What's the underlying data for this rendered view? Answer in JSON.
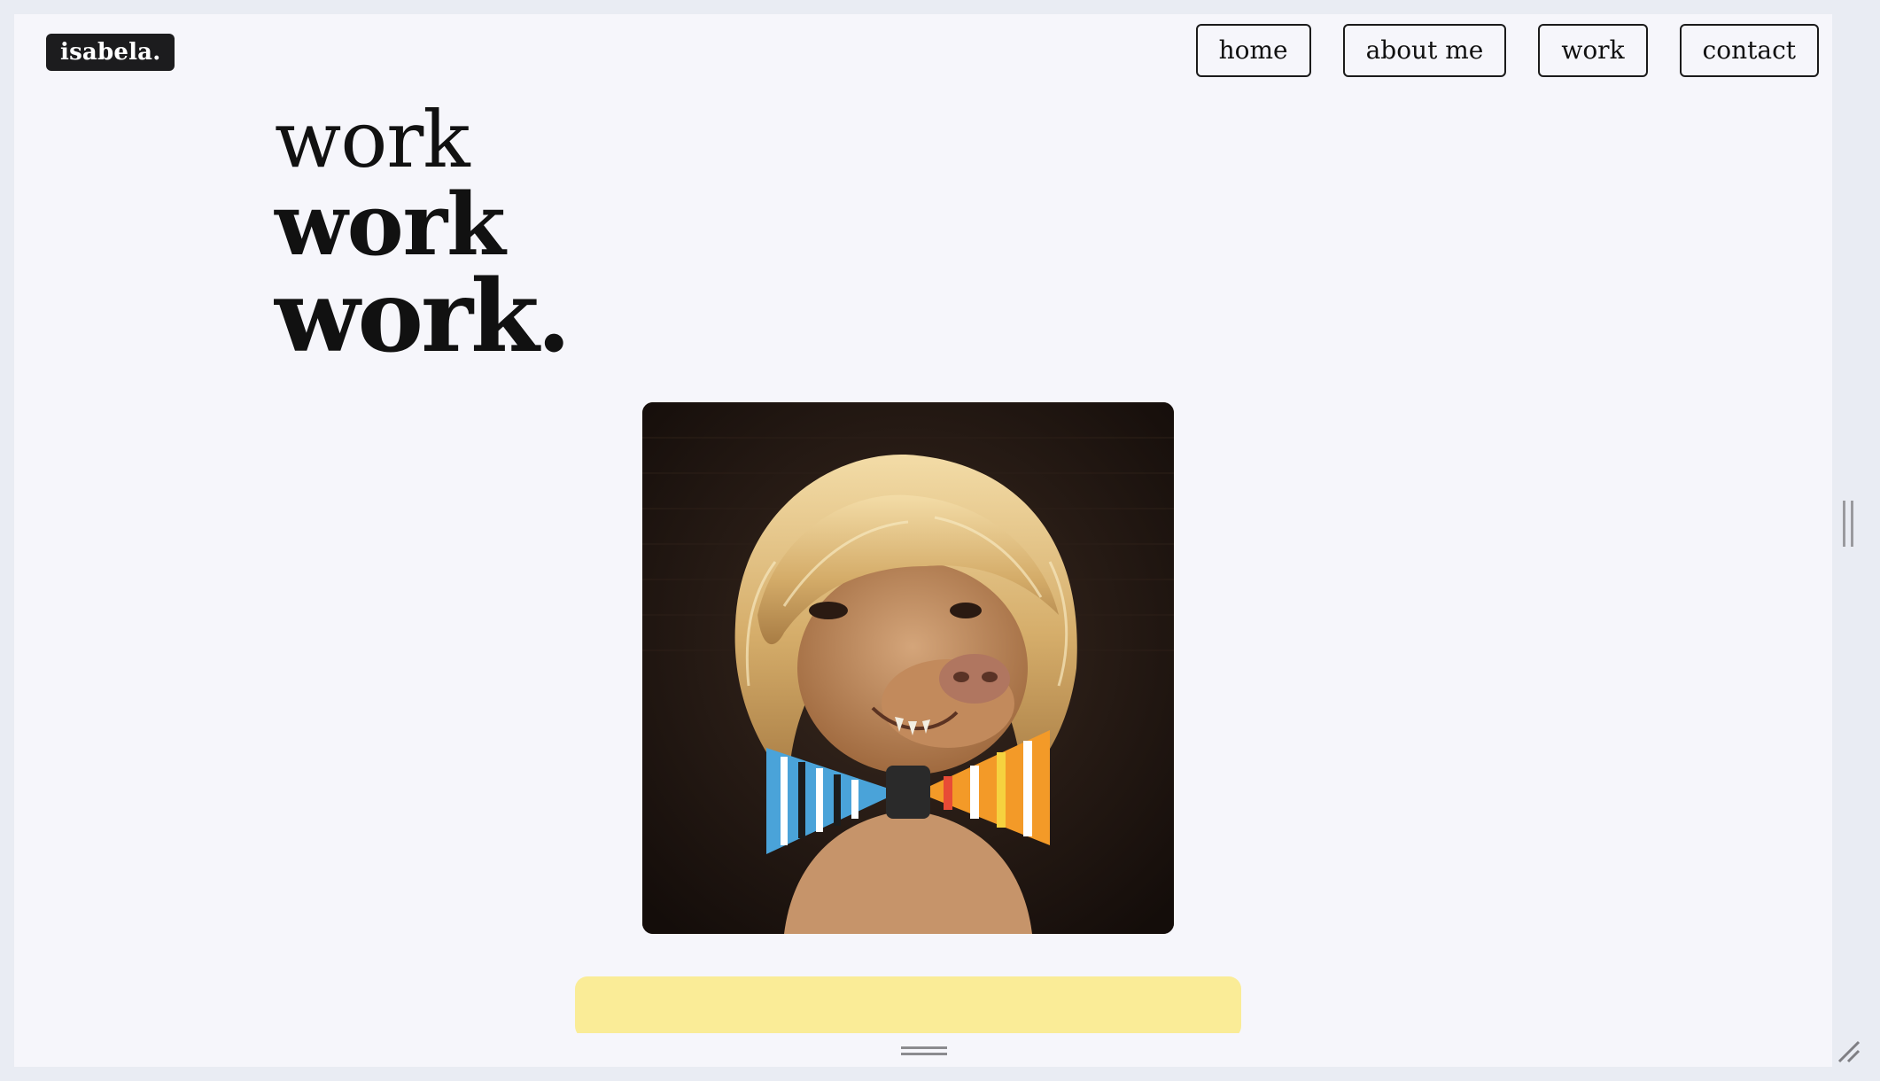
{
  "brand": {
    "logo_text": "isabela."
  },
  "nav": {
    "items": [
      {
        "label": "home"
      },
      {
        "label": "about me"
      },
      {
        "label": "work"
      },
      {
        "label": "contact"
      }
    ]
  },
  "hero": {
    "line1": "work",
    "line2": "work",
    "line3": "work."
  },
  "photo": {
    "subject_icon": "dog-in-wig-with-bowtie-image"
  },
  "colors": {
    "page_bg": "#f6f6fb",
    "logo_bg": "#1c1c1e",
    "card_yellow": "#faec97"
  }
}
